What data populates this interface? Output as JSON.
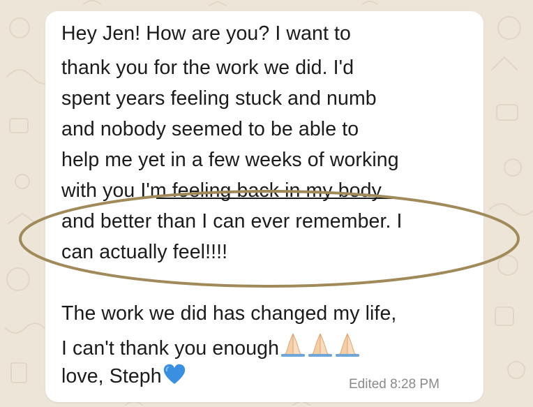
{
  "message": {
    "lines": [
      "Hey Jen!  How are you?  I want to",
      "thank you for the work we did.  I'd",
      "spent years feeling stuck and numb",
      "and nobody seemed to be able to",
      "help me yet in a few weeks of working",
      "with you I'm feeling back in my body",
      "and better than I can ever remember. I",
      "can actually feel!!!!",
      "The work we did has changed my life,",
      "I can't thank you enough",
      "love,  Steph"
    ],
    "edited_label": "Edited",
    "time": "8:28 PM"
  },
  "icons": {
    "praying_hands": "praying-hands-icon",
    "blue_heart": "blue-heart-icon"
  },
  "colors": {
    "wallpaper": "#ece5d8",
    "bubble": "#ffffff",
    "highlight_ellipse": "#a08a5a",
    "heart": "#3b8fe0"
  }
}
